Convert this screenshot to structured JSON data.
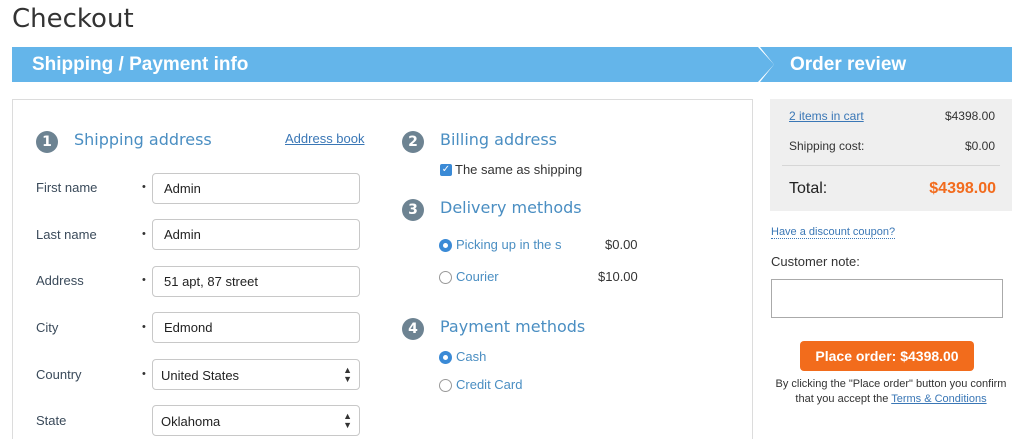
{
  "page": {
    "title": "Checkout"
  },
  "banner": {
    "left_title": "Shipping / Payment info",
    "right_title": "Order review"
  },
  "shipping": {
    "step": "1",
    "title": "Shipping address",
    "address_book_link": "Address book",
    "required_mark": "•",
    "fields": {
      "first_name": {
        "label": "First name",
        "value": "Admin"
      },
      "last_name": {
        "label": "Last name",
        "value": "Admin"
      },
      "address": {
        "label": "Address",
        "value": "51 apt, 87 street"
      },
      "city": {
        "label": "City",
        "value": "Edmond"
      },
      "country": {
        "label": "Country",
        "value": "United States"
      },
      "state": {
        "label": "State",
        "value": "Oklahoma"
      }
    }
  },
  "billing": {
    "step": "2",
    "title": "Billing address",
    "same_as_shipping": "The same as shipping",
    "checked": true
  },
  "delivery": {
    "step": "3",
    "title": "Delivery methods",
    "options": [
      {
        "label": "Picking up in the s",
        "price": "$0.00",
        "selected": true
      },
      {
        "label": "Courier",
        "price": "$10.00",
        "selected": false
      }
    ]
  },
  "payment": {
    "step": "4",
    "title": "Payment methods",
    "options": [
      {
        "label": "Cash",
        "selected": true
      },
      {
        "label": "Credit Card",
        "selected": false
      }
    ]
  },
  "summary": {
    "items_label": "2 items in cart",
    "items_value": "$4398.00",
    "shipping_label": "Shipping cost:",
    "shipping_value": "$0.00",
    "total_label": "Total:",
    "total_value": "$4398.00"
  },
  "coupon_link": "Have a discount coupon?",
  "customer_note": {
    "label": "Customer note:",
    "value": ""
  },
  "place_order": {
    "button": "Place order: $4398.00",
    "terms_text": "By clicking the \"Place order\" button you confirm that you accept the ",
    "terms_link": "Terms & Conditions"
  },
  "colors": {
    "banner": "#64b5ea",
    "accent_link": "#3a77b6",
    "section_title": "#4a8ec2",
    "order_button": "#f26c1c",
    "total": "#f26b1d"
  }
}
